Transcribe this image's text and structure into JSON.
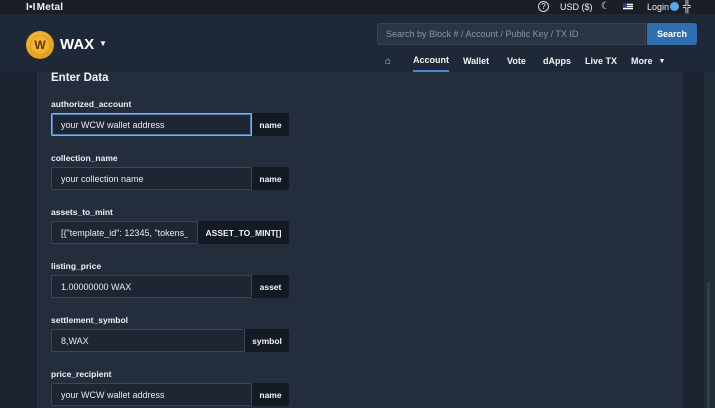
{
  "topbar": {
    "brand": "Metal",
    "brand_mark": "I•I",
    "help_icon": "?",
    "currency": "USD ($)",
    "login": "Login"
  },
  "header": {
    "chain": "WAX",
    "search": {
      "placeholder": "Search by Block # / Account / Public Key / TX ID",
      "button": "Search"
    },
    "nav": {
      "home_icon": "⌂",
      "items": [
        "Account",
        "Wallet",
        "Vote",
        "dApps",
        "Live TX",
        "More"
      ],
      "active": "Account"
    }
  },
  "form": {
    "title": "Enter Data",
    "fields": [
      {
        "label": "authorized_account",
        "value": "your WCW wallet address",
        "type": "name"
      },
      {
        "label": "collection_name",
        "value": "your collection name",
        "type": "name"
      },
      {
        "label": "assets_to_mint",
        "value": "[{\"template_id\": 12345, \"tokens_t",
        "type": "ASSET_TO_MINT[]"
      },
      {
        "label": "listing_price",
        "value": "1.00000000 WAX",
        "type": "asset"
      },
      {
        "label": "settlement_symbol",
        "value": "8,WAX",
        "type": "symbol"
      },
      {
        "label": "price_recipient",
        "value": "your WCW wallet address",
        "type": "name"
      }
    ]
  },
  "colors": {
    "background": "#1b2330",
    "panel": "#232d3c",
    "accent": "#2f6db1",
    "active_underline": "#4a88d0"
  }
}
